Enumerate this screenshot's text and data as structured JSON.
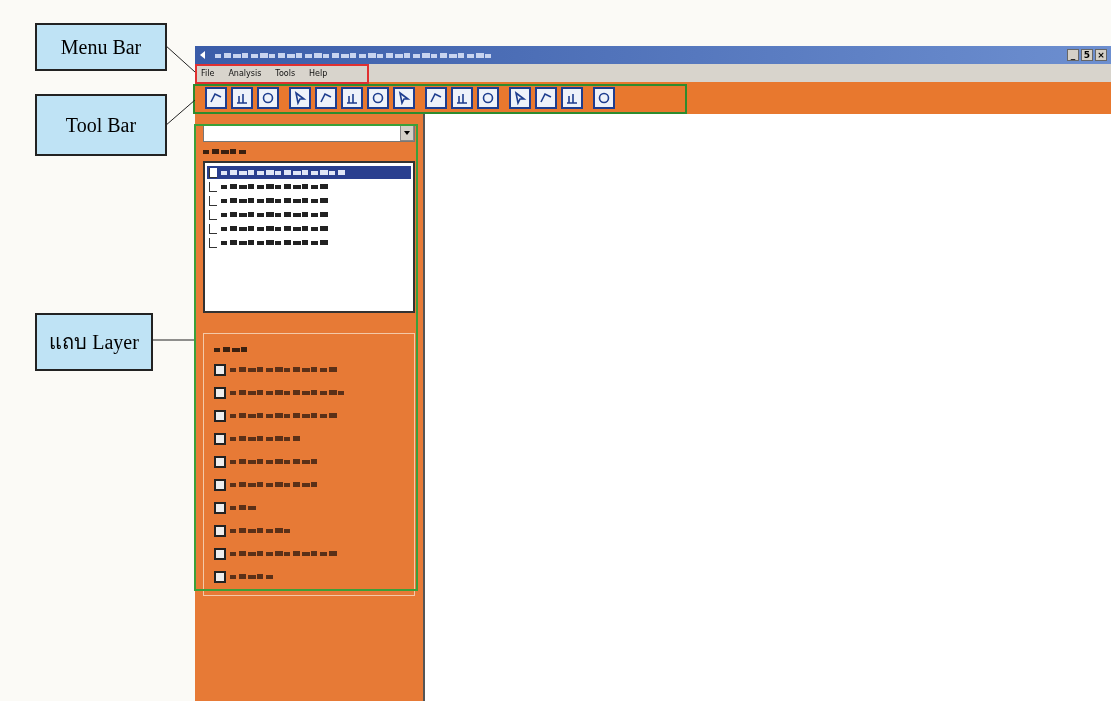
{
  "callouts": [
    {
      "label": "Menu Bar"
    },
    {
      "label": "Tool Bar"
    },
    {
      "label": "แถบ Layer"
    }
  ],
  "window": {
    "controls": [
      "_",
      "5",
      "×"
    ]
  },
  "menu": [
    {
      "label": "File"
    },
    {
      "label": "Analysis"
    },
    {
      "label": "Tools"
    },
    {
      "label": "Help"
    }
  ],
  "layer_list": [
    {
      "checked": false,
      "selected": true
    },
    {
      "checked": false,
      "selected": false
    },
    {
      "checked": false,
      "selected": false
    },
    {
      "checked": false,
      "selected": false
    },
    {
      "checked": false,
      "selected": false
    },
    {
      "checked": false,
      "selected": false
    }
  ],
  "options": [
    {
      "checked": false
    },
    {
      "checked": false
    },
    {
      "checked": false
    },
    {
      "checked": false
    },
    {
      "checked": false
    },
    {
      "checked": false
    },
    {
      "checked": false
    },
    {
      "checked": false
    },
    {
      "checked": false
    },
    {
      "checked": false
    }
  ]
}
